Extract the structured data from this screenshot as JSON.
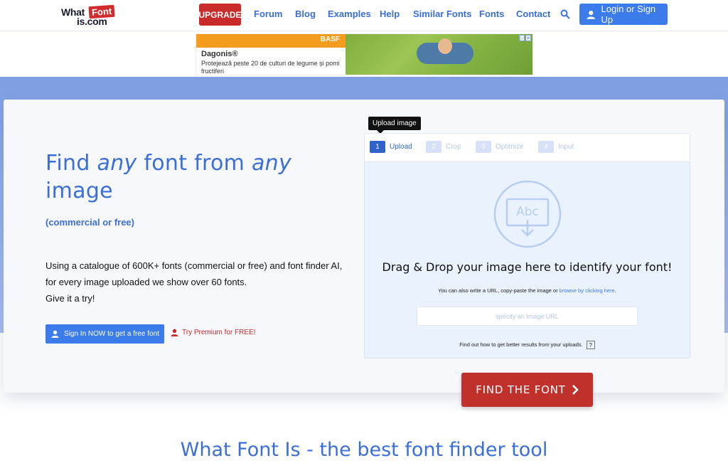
{
  "logo": {
    "line1": "What",
    "highlight": "Font",
    "line2": "is.com"
  },
  "nav": {
    "upgrade": "UPGRADE",
    "links": [
      "Forum",
      "Blog",
      "Examples",
      "Help",
      "Similar Fonts",
      "Fonts",
      "Contact"
    ],
    "login": "Login or Sign Up"
  },
  "ad": {
    "brand": "BASF",
    "title": "Dagonis®",
    "description": "Protejează peste 20 de culturi de legume și pomi fructiferi"
  },
  "hero": {
    "title_part1": "Find ",
    "title_em1": "any",
    "title_part2": " font from ",
    "title_em2": "any",
    "title_part3": " image",
    "subtitle": "(commercial or free)",
    "description_line1": "Using a catalogue of 600K+ fonts (commercial or free) and font finder AI,",
    "description_line2": "for every image uploaded we show over 60 fonts.",
    "description_line3": "Give it a try!",
    "signin_label": "Sign In NOW to get a free font",
    "premium_label": "Try Premium for FREE!"
  },
  "upload": {
    "tooltip": "Upload image",
    "steps": [
      {
        "num": "1",
        "label": "Upload"
      },
      {
        "num": "2",
        "label": "Crop"
      },
      {
        "num": "3",
        "label": "Optimize"
      },
      {
        "num": "4",
        "label": "Input"
      }
    ],
    "icon_text": "Abc",
    "drop_title": "Drag & Drop your image here to identify your font!",
    "alt_text": "You can also write a URL, copy-paste the image or ",
    "browse_link": "browse by clicking here",
    "alt_text_end": ".",
    "url_placeholder": "specify an Image URL",
    "tips_text": "Find out how to get better results from your uploads.",
    "tips_q": "?",
    "find_button": "FIND THE FONT"
  },
  "bottom": {
    "title": "What Font Is - the best font finder tool"
  },
  "colors": {
    "accent": "#3b6fd8",
    "brand_red": "#c0312b",
    "hero_bg": "#8aa6e6"
  }
}
